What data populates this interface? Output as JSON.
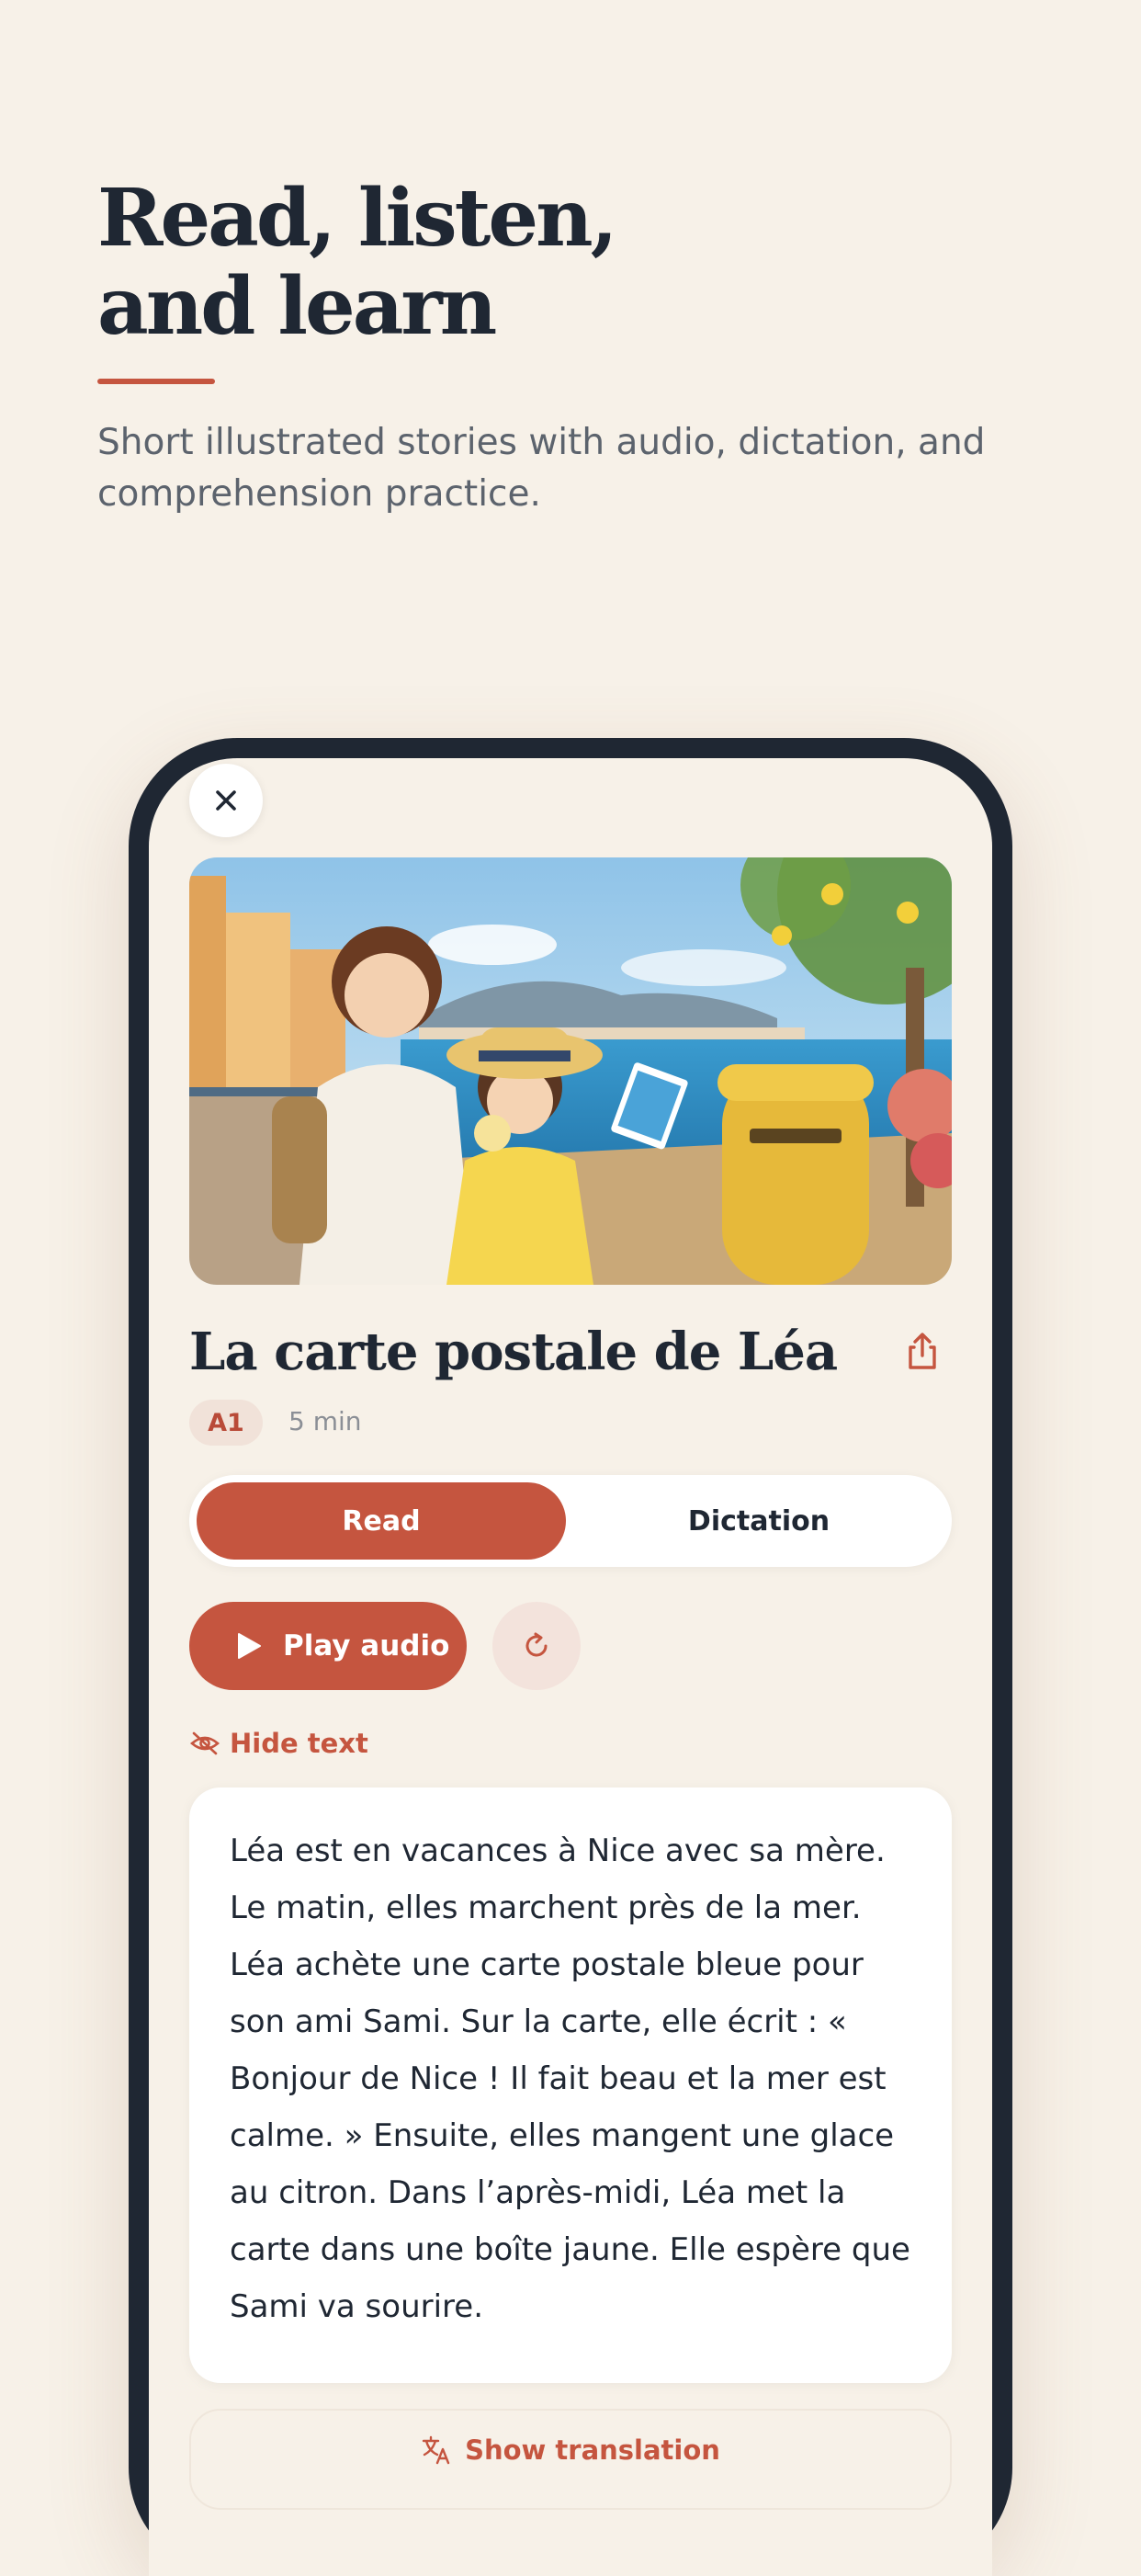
{
  "hero": {
    "title_line1": "Read, listen,",
    "title_line2": "and learn",
    "subtitle": "Short illustrated stories with audio, dictation, and comprehension practice."
  },
  "story": {
    "title": "La carte postale de Léa",
    "level": "A1",
    "duration": "5 min",
    "text": "Léa est en vacances à Nice avec sa mère. Le matin, elles marchent près de la mer. Léa achète une carte postale bleue pour son ami Sami. Sur la carte, elle écrit : « Bonjour de Nice ! Il fait beau et la mer est calme. » Ensuite, elles mangent une glace au citron. Dans l’après-midi, Léa met la carte dans une boîte jaune. Elle espère que Sami va sourire."
  },
  "tabs": {
    "read_label": "Read",
    "dictation_label": "Dictation",
    "active": "Read"
  },
  "controls": {
    "play_label": "Play audio",
    "hide_text_label": "Hide text",
    "translation_label": "Show translation"
  },
  "icons": {
    "close": "close-icon",
    "share": "share-icon",
    "play": "play-icon",
    "replay": "replay-icon",
    "hide": "eye-off-icon",
    "translate": "translate-icon"
  },
  "colors": {
    "accent": "#c5553f",
    "background": "#f7f1e8",
    "frame": "#1f2733",
    "text": "#1f2733",
    "muted": "#8b8f96"
  }
}
